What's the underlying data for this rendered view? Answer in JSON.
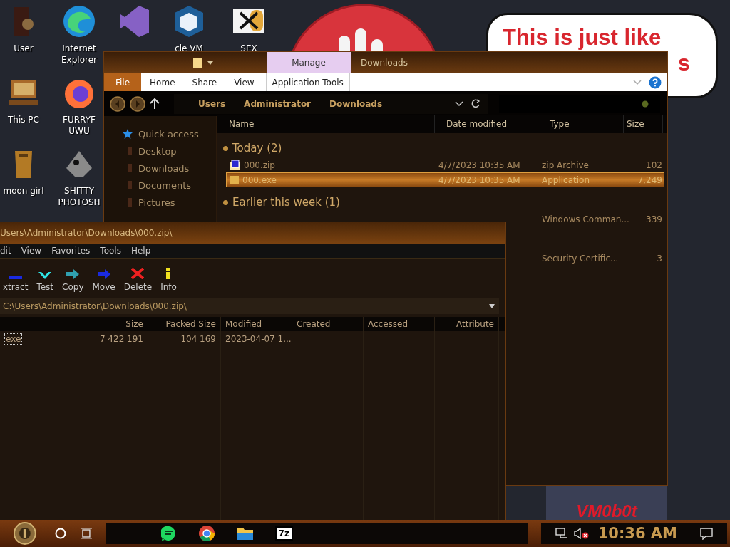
{
  "desktop_icons": [
    {
      "label": "User",
      "kind": "door"
    },
    {
      "label": "Internet Explorer",
      "kind": "edge"
    },
    {
      "kind": "vs"
    },
    {
      "label": "cle VM",
      "kind": "cube"
    },
    {
      "label": "SEX",
      "kind": "hex"
    },
    {
      "label": "This PC",
      "kind": "pc"
    },
    {
      "label": "FURRYF UWU",
      "kind": "fox"
    },
    {
      "label": "moon girl",
      "kind": "bin"
    },
    {
      "label": "SHITTY PHOTOSH",
      "kind": "gimp"
    }
  ],
  "speech_bubble": {
    "line_1": "This is just like",
    "line_2": "s"
  },
  "background_window": {
    "text": "VM0b0t"
  },
  "explorer": {
    "title": "Downloads",
    "context_tab": "Manage",
    "ribbon_tabs": [
      {
        "label": "File",
        "selected": true
      },
      {
        "label": "Home",
        "selected": false
      },
      {
        "label": "Share",
        "selected": false
      },
      {
        "label": "View",
        "selected": false
      },
      {
        "label": "Application Tools",
        "selected": false
      }
    ],
    "breadcrumbs": [
      "Users",
      "Administrator",
      "Downloads"
    ],
    "nav": [
      {
        "label": "Quick access",
        "kind": "star"
      },
      {
        "label": "Desktop",
        "kind": "folder"
      },
      {
        "label": "Downloads",
        "kind": "folder"
      },
      {
        "label": "Documents",
        "kind": "folder"
      },
      {
        "label": "Pictures",
        "kind": "folder"
      }
    ],
    "columns": [
      "Name",
      "Date modified",
      "Type",
      "Size"
    ],
    "groups": [
      {
        "label": "Today (2)",
        "items": [
          {
            "name": "000.zip",
            "date": "4/7/2023 10:35 AM",
            "type": "zip Archive",
            "size": "102",
            "kind": "zip",
            "selected": false
          },
          {
            "name": "000.exe",
            "date": "4/7/2023 10:35 AM",
            "type": "Application",
            "size": "7,249",
            "kind": "exe",
            "selected": true
          }
        ]
      },
      {
        "label": "Earlier this week (1)",
        "items": [
          {
            "type": "Windows Comman...",
            "size": "339",
            "selected": false
          }
        ]
      },
      {
        "items": [
          {
            "type": "Security Certific...",
            "size": "3",
            "selected": false
          }
        ]
      }
    ]
  },
  "sevenzip": {
    "title": "Users\\Administrator\\Downloads\\000.zip\\",
    "menu": [
      "dit",
      "View",
      "Favorites",
      "Tools",
      "Help"
    ],
    "tools": [
      {
        "label": "xtract",
        "kind": "extract"
      },
      {
        "label": "Test",
        "kind": "test"
      },
      {
        "label": "Copy",
        "kind": "copy"
      },
      {
        "label": "Move",
        "kind": "move"
      },
      {
        "label": "Delete",
        "kind": "delete"
      },
      {
        "label": "Info",
        "kind": "info"
      }
    ],
    "path": "C:\\Users\\Administrator\\Downloads\\000.zip\\",
    "columns": [
      "",
      "Size",
      "Packed Size",
      "Modified",
      "Created",
      "Accessed",
      "Attribute"
    ],
    "rows": [
      [
        "exe",
        "7 422 191",
        "104 169",
        "2023-04-07 1...",
        "",
        "",
        ""
      ]
    ]
  },
  "taskbar": {
    "apps": [
      {
        "kind": "chat"
      },
      {
        "kind": "chrome"
      },
      {
        "kind": "folder"
      },
      {
        "kind": "sevenzip",
        "glyph": "7z"
      }
    ],
    "clock": "10:36 AM",
    "volume_muted": true
  }
}
